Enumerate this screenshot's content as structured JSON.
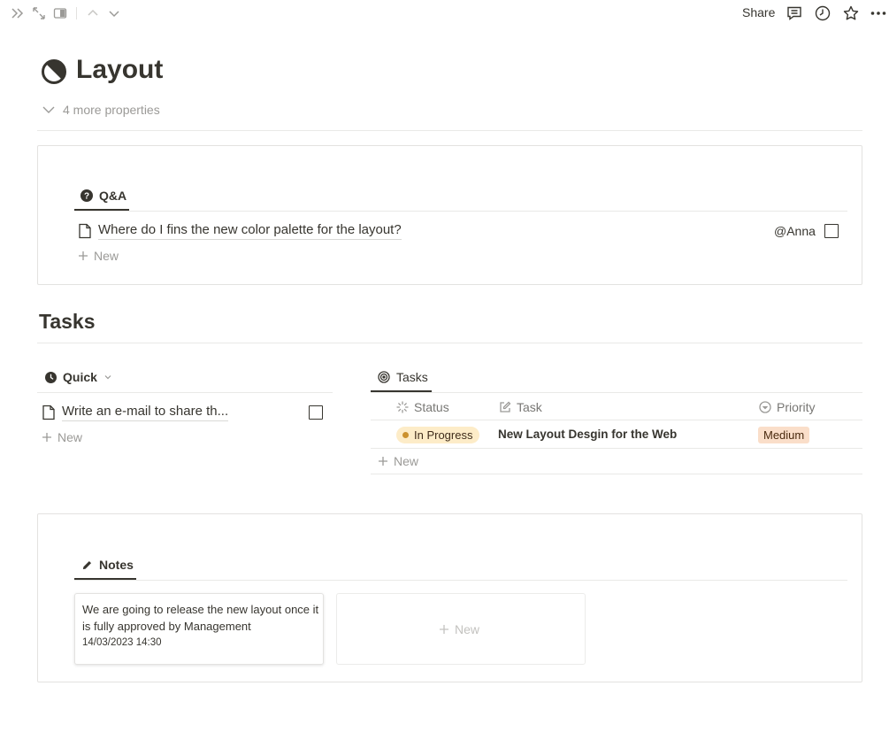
{
  "topbar": {
    "share_label": "Share"
  },
  "page": {
    "icon": "half-circle-icon",
    "title": "Layout",
    "properties_label": "4 more properties"
  },
  "qa": {
    "tab_label": "Q&A",
    "row": {
      "title": "Where do I fins the new color palette for the layout?",
      "assignee": "@Anna",
      "checked": false
    },
    "new_label": "New"
  },
  "tasks_section": {
    "heading": "Tasks"
  },
  "quick": {
    "tab_label": "Quick",
    "row": {
      "title": "Write an e-mail to share th...",
      "checked": false
    },
    "new_label": "New"
  },
  "tasks_db": {
    "tab_label": "Tasks",
    "columns": {
      "status": "Status",
      "task": "Task",
      "priority": "Priority"
    },
    "rows": [
      {
        "status": "In Progress",
        "task": "New Layout Desgin for the Web",
        "priority": "Medium"
      }
    ],
    "new_label": "New",
    "colors": {
      "status_bg": "#fdecc8",
      "status_dot": "#cb912f",
      "priority_bg": "#fadec9"
    }
  },
  "notes": {
    "tab_label": "Notes",
    "cards": [
      {
        "text": "We are going to release the new layout once it is fully approved by Management",
        "date": "14/03/2023 14:30"
      }
    ],
    "new_label": "New"
  }
}
